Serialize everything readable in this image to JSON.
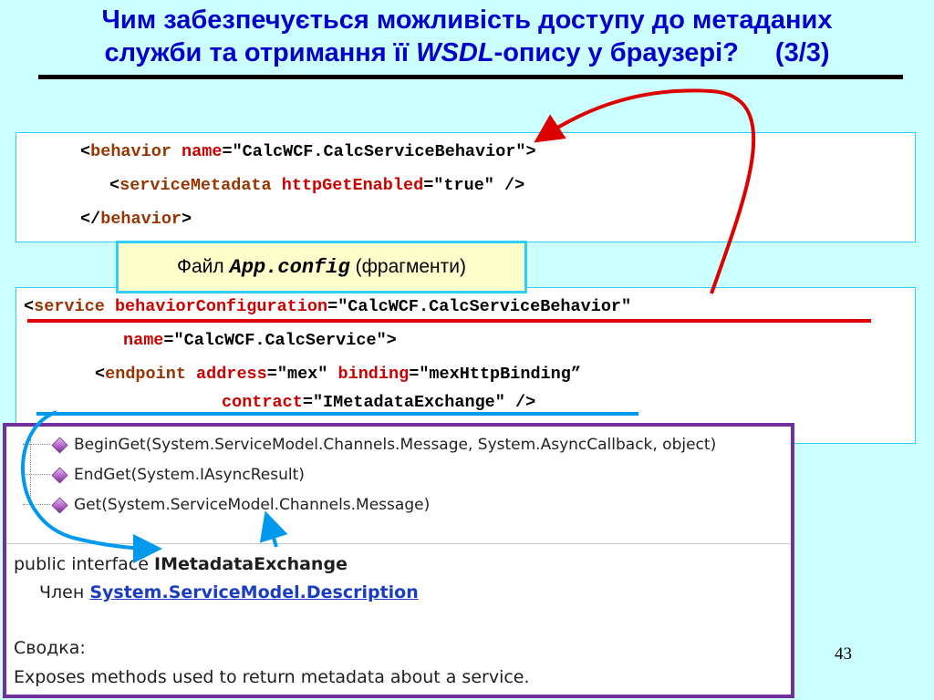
{
  "slide": {
    "title_line1": "Чим забезпечується можливість доступу до метаданих",
    "title_line2_a": "служби та отримання її ",
    "title_line2_wsdl": "WSDL",
    "title_line2_b": "-опису у браузері?",
    "title_counter": "(3/3)",
    "page_number": "43"
  },
  "box1": {
    "l1_lt": "<",
    "l1_tag": "behavior",
    "l1_attr": "name",
    "l1_eq": "=",
    "l1_val": "\"CalcWCF.CalcServiceBehavior\"",
    "l1_gt": ">",
    "l2_lt": "<",
    "l2_tag": "serviceMetadata",
    "l2_attr": "httpGetEnabled",
    "l2_eq": "=",
    "l2_val": "\"true\"",
    "l2_end": " />",
    "l3_lt": "</",
    "l3_tag": "behavior",
    "l3_gt": ">"
  },
  "file_label": {
    "prefix": "Файл",
    "name": "App.config",
    "suffix": "(фрагменти)"
  },
  "box2": {
    "l1_lt": "<",
    "l1_tag": "service",
    "l1_attr": "behaviorConfiguration",
    "l1_eq": "=",
    "l1_val": "\"CalcWCF.CalcServiceBehavior\"",
    "l2_attr": "name",
    "l2_eq": "=",
    "l2_val": "\"CalcWCF.CalcService\">",
    "l3_lt": "<",
    "l3_tag": "endpoint",
    "l3_attr1": "address",
    "l3_eq1": "=",
    "l3_val1": "\"mex\"",
    "l3_attr2": "binding",
    "l3_eq2": "=",
    "l3_val2": "\"mexHttpBinding”",
    "l4_attr": "contract",
    "l4_eq": "=",
    "l4_val": "\"IMetadataExchange\"",
    "l4_end": " />"
  },
  "object_browser": {
    "members": [
      "BeginGet(System.ServiceModel.Channels.Message, System.AsyncCallback, object)",
      "EndGet(System.IAsyncResult)",
      "Get(System.ServiceModel.Channels.Message)"
    ],
    "decl_prefix": "public interface ",
    "decl_name": "IMetadataExchange",
    "member_of_label": "Член ",
    "member_of_link": "System.ServiceModel.Description",
    "summary_heading": "Сводка:",
    "summary_text": "Exposes methods used to return metadata about a service."
  },
  "colors": {
    "background": "#ccffff",
    "title": "#0000cc",
    "tag": "#993300",
    "attribute": "#cc0000",
    "red_arrow": "#dd0000",
    "blue_arrow": "#0099ee",
    "panel_border": "#7030a0"
  },
  "icons": {
    "member_icon": "purple-method-cube-icon"
  }
}
